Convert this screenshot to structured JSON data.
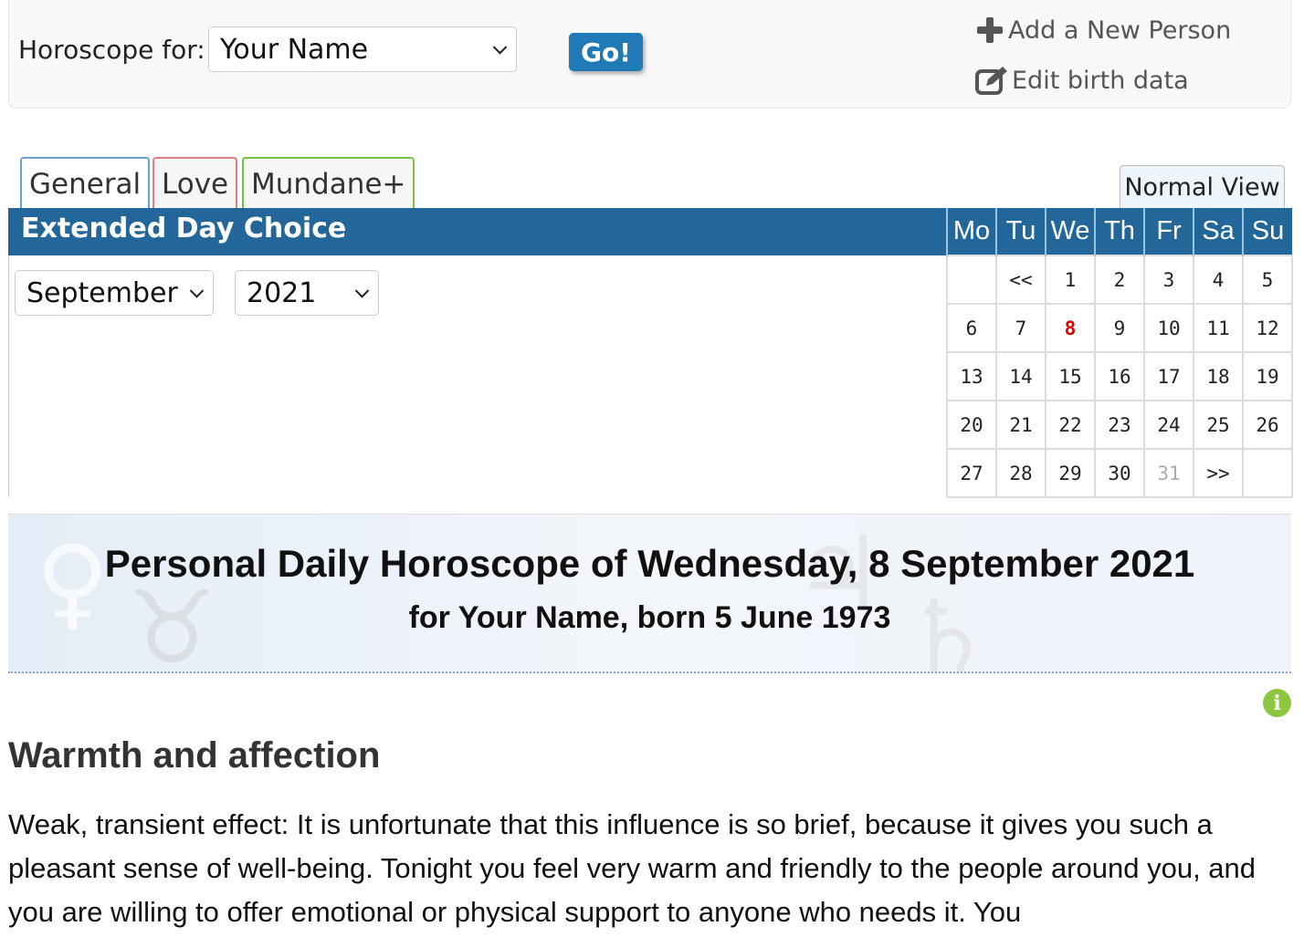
{
  "header": {
    "label": "Horoscope for:",
    "person": "Your Name",
    "go": "Go!",
    "add_person": "Add a New Person",
    "edit_birth": "Edit birth data"
  },
  "tabs": [
    {
      "label": "General",
      "color": "#6a9fd8"
    },
    {
      "label": "Love",
      "color": "#e08080"
    },
    {
      "label": "Mundane+",
      "color": "#7ac142"
    }
  ],
  "normal_view": "Normal View",
  "day_choice": {
    "title": "Extended Day Choice",
    "month": "September",
    "year": "2021"
  },
  "calendar": {
    "weekdays": [
      "Mo",
      "Tu",
      "We",
      "Th",
      "Fr",
      "Sa",
      "Su"
    ],
    "rows": [
      [
        "",
        "<<",
        "1",
        "2",
        "3",
        "4",
        "5"
      ],
      [
        "6",
        "7",
        "8",
        "9",
        "10",
        "11",
        "12"
      ],
      [
        "13",
        "14",
        "15",
        "16",
        "17",
        "18",
        "19"
      ],
      [
        "20",
        "21",
        "22",
        "23",
        "24",
        "25",
        "26"
      ],
      [
        "27",
        "28",
        "29",
        "30",
        "31",
        ">>",
        ""
      ]
    ],
    "selected_day": "8",
    "dim_day": "31"
  },
  "banner": {
    "title": "Personal Daily Horoscope of Wednesday, 8 September 2021",
    "subtitle": "for Your Name, born 5 June 1973"
  },
  "section": {
    "title": "Warmth and affection",
    "text": "Weak, transient effect: It is unfortunate that this influence is so brief, because it gives you such a pleasant sense of well-being. Tonight you feel very warm and friendly to the people around you, and you are willing to offer emotional or physical support to anyone who needs it. You"
  }
}
